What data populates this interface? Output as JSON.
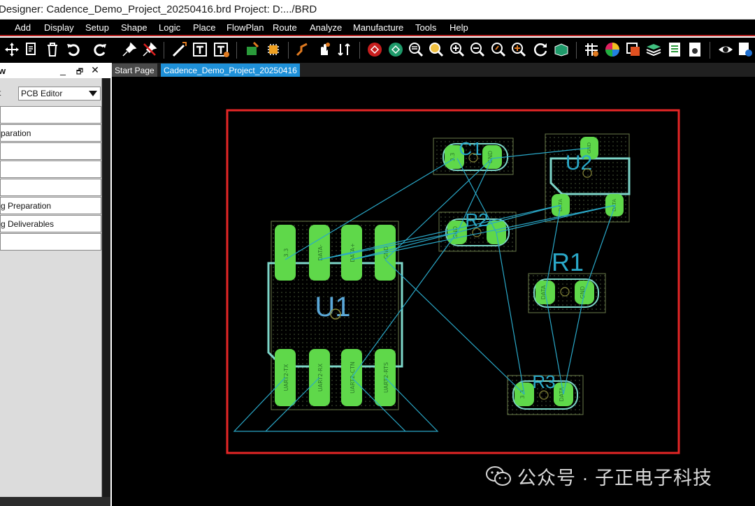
{
  "window": {
    "title": "Designer: Cadence_Demo_Project_20250416.brd  Project: D:.../BRD"
  },
  "menu": [
    "Add",
    "Display",
    "Setup",
    "Shape",
    "Logic",
    "Place",
    "FlowPlan",
    "Route",
    "Analyze",
    "Manufacture",
    "Tools",
    "Help"
  ],
  "toolbar": {
    "icons": [
      "move-icon",
      "copy-icon",
      "delete-icon",
      "undo-icon",
      "redo-icon",
      "pin-icon",
      "unpin-icon",
      "add-line-icon",
      "add-text-icon",
      "change-text-icon",
      "place-icon",
      "component-icon",
      "route-icon",
      "slide-icon",
      "fanout-icon",
      "drc-icon",
      "shape-icon",
      "zoom-fit-icon",
      "zoom-search-icon",
      "zoom-in-icon",
      "zoom-out-icon",
      "zoom-previous-icon",
      "zoom-world-icon",
      "redraw-icon",
      "3d-view-icon",
      "grid-icon",
      "color-icon",
      "layer-icon",
      "stack-icon",
      "report-icon",
      "settings-icon",
      "visibility-icon",
      "info-icon"
    ]
  },
  "panel": {
    "title": "w",
    "editor_label": "t",
    "editor_value": "PCB Editor",
    "items": [
      "",
      "paration",
      "",
      "",
      "",
      "g Preparation",
      "g Deliverables",
      ""
    ]
  },
  "tabs": {
    "start": "Start Page",
    "active": "Cadence_Demo_Project_20250416"
  },
  "board": {
    "outline_color": "#e52626",
    "ratsnest_color": "#2aa8c8",
    "pad_color": "#5fd84a",
    "silk_color": "#7dd6c9",
    "components": [
      {
        "ref": "U1",
        "pins_top": [
          "3.3",
          "DATA-",
          "DATA+",
          "GND"
        ],
        "pins_bottom": [
          "UART2-TX",
          "UART2-RX",
          "UART2-CTN",
          "UART2-RTS"
        ]
      },
      {
        "ref": "U2",
        "pins": [
          "GND",
          "DATA",
          "DATA"
        ]
      },
      {
        "ref": "C1",
        "pins": [
          "3.3",
          "GND"
        ]
      },
      {
        "ref": "R1",
        "pins": [
          "DATA",
          "GND"
        ]
      },
      {
        "ref": "R2",
        "pins": [
          "GND",
          ""
        ]
      },
      {
        "ref": "R3",
        "pins": [
          "3.3",
          "DATA"
        ]
      }
    ]
  },
  "watermark": {
    "text": "公众号 · 子正电子科技"
  }
}
